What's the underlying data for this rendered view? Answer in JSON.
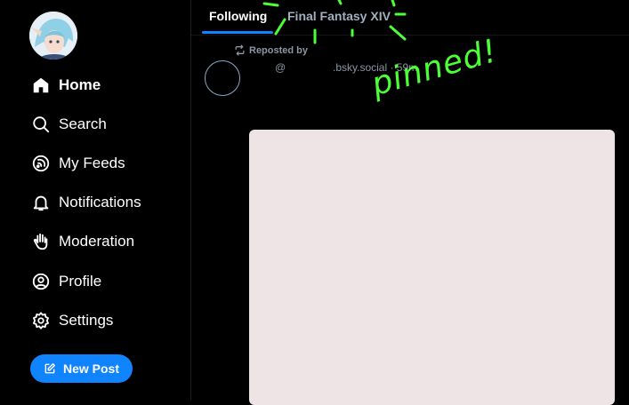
{
  "sidebar": {
    "items": [
      {
        "label": "Home",
        "icon": "home-icon",
        "active": true
      },
      {
        "label": "Search",
        "icon": "search-icon",
        "active": false
      },
      {
        "label": "My Feeds",
        "icon": "feeds-icon",
        "active": false
      },
      {
        "label": "Notifications",
        "icon": "bell-icon",
        "active": false
      },
      {
        "label": "Moderation",
        "icon": "hand-icon",
        "active": false
      },
      {
        "label": "Profile",
        "icon": "user-circle-icon",
        "active": false
      },
      {
        "label": "Settings",
        "icon": "gear-icon",
        "active": false
      }
    ],
    "new_post_label": "New Post"
  },
  "main": {
    "tabs": [
      {
        "label": "Following",
        "active": true
      },
      {
        "label": "Final Fantasy XIV",
        "active": false
      }
    ],
    "post": {
      "repost_label": "Reposted by",
      "handle_prefix": "@",
      "handle_domain": ".bsky.social · 59m"
    },
    "annotation": "pinned!"
  },
  "colors": {
    "accent": "#1083fe",
    "annotation": "#4dff36",
    "background": "#000000",
    "muted_text": "#8b96a3",
    "image_placeholder": "#efe4e5"
  }
}
